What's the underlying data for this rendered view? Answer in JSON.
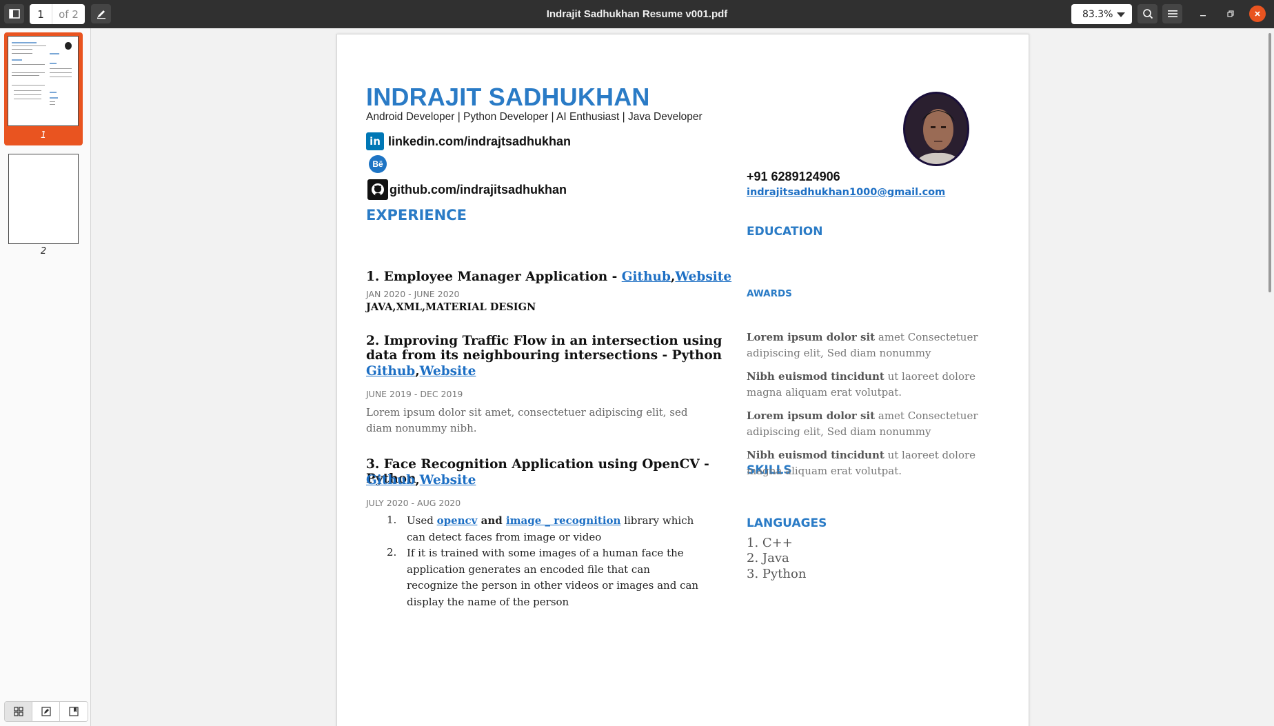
{
  "toolbar": {
    "page_current": "1",
    "page_total": "of 2",
    "title": "Indrajit Sadhukhan Resume v001.pdf",
    "zoom": "83.3%"
  },
  "sidebar": {
    "thumbnails": [
      {
        "label": "1",
        "selected": true
      },
      {
        "label": "2",
        "selected": false
      }
    ]
  },
  "resume": {
    "name": "INDRAJIT SADHUKHAN",
    "tagline": "Android Developer | Python Developer | AI Enthusiast | Java Developer",
    "linkedin_icon": "in",
    "behance_icon": "Bē",
    "linkedin": "linkedin.com/indrajtsadhukhan",
    "github": "github.com/indrajitsadhukhan",
    "phone": "+91 6289124906",
    "email": "indrajitsadhukhan1000@gmail.com",
    "experience_heading": "EXPERIENCE",
    "education_heading": "EDUCATION",
    "awards_heading": "AWARDS",
    "skills_heading": "SKILLS",
    "languages_heading": "LANGUAGES",
    "link_github": "Github",
    "link_website": "Website",
    "jobs": [
      {
        "title": "1. Employee  Manager Application - ",
        "date": "JAN  2020 - JUNE 2020",
        "tech": "JAVA,XML,MATERIAL DESIGN"
      },
      {
        "title": "2. Improving Traffic Flow in an intersection using data from its neighbouring intersections - Python",
        "date": "JUNE 2019 - DEC  2019",
        "desc": "Lorem ipsum dolor sit amet, consectetuer adipiscing elit, sed diam nonummy nibh."
      },
      {
        "title": "3. Face Recognition Application using OpenCV - Python",
        "date": "JULY 2020 - AUG 2020",
        "items": [
          {
            "num": "1.",
            "pre": "Used ",
            "link1": "opencv",
            "mid": " and ",
            "link2": "image _ recognition",
            "post": " library which can detect faces from image or video"
          },
          {
            "num": "2.",
            "text": "If it is trained with some images of a human face the application generates an encoded file that can recognize the person in other videos or images and can display the name of the person"
          }
        ]
      }
    ],
    "awards": [
      {
        "bold": "Lorem ipsum dolor sit",
        "rest": " amet Consectetuer adipiscing elit, Sed diam nonummy"
      },
      {
        "bold": "Nibh euismod tincidunt",
        "rest": " ut laoreet dolore magna aliquam erat volutpat."
      },
      {
        "bold": "Lorem ipsum dolor sit",
        "rest": " amet Consectetuer adipiscing elit, Sed diam nonummy"
      },
      {
        "bold": "Nibh euismod tincidunt",
        "rest": " ut laoreet dolore magna aliquam erat volutpat."
      }
    ],
    "languages": [
      "1. C++",
      "2. Java",
      "3. Python"
    ]
  },
  "colors": {
    "accent": "#2a7bc6",
    "link": "#1d6fc4",
    "selection": "#e95420",
    "toolbar": "#303030"
  },
  "icons": [
    "sidebar-toggle-icon",
    "annotate-icon",
    "search-icon",
    "hamburger-menu-icon",
    "minimize-icon",
    "restore-icon",
    "close-icon",
    "grid-icon",
    "edit-icon",
    "bookmark-icon",
    "linkedin-icon",
    "behance-icon",
    "github-icon"
  ]
}
